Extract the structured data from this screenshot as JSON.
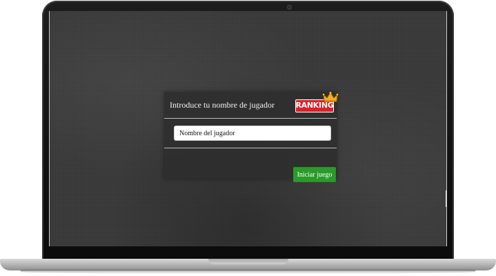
{
  "panel": {
    "title": "Introduce tu nombre de jugador",
    "ranking_label": "RANKING",
    "ranking_icon": "crown-icon",
    "name_placeholder": "Nombre del jugador",
    "name_value": "",
    "start_label": "Iniciar juego"
  },
  "colors": {
    "ranking_accent": "#d9222a",
    "start_button": "#2a9a2a",
    "background": "#3a3a3a"
  }
}
